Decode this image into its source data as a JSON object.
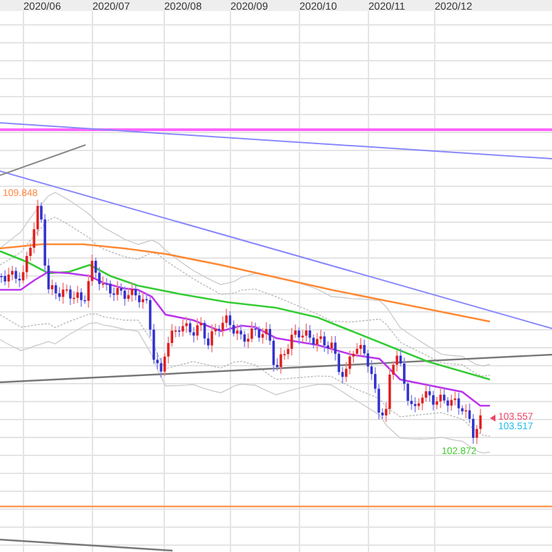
{
  "time_axis": {
    "labels": [
      "2020/06",
      "2020/07",
      "2020/08",
      "2020/09",
      "2020/10",
      "2020/11",
      "2020/12"
    ]
  },
  "price_labels": [
    {
      "kind": "high",
      "text": "109.848",
      "color": "#ff8844"
    },
    {
      "kind": "bid",
      "text": "103.557",
      "color": "#ee4466"
    },
    {
      "kind": "ask",
      "text": "103.517",
      "color": "#22bbee"
    },
    {
      "kind": "low",
      "text": "102.872",
      "color": "#44cc33"
    }
  ]
}
